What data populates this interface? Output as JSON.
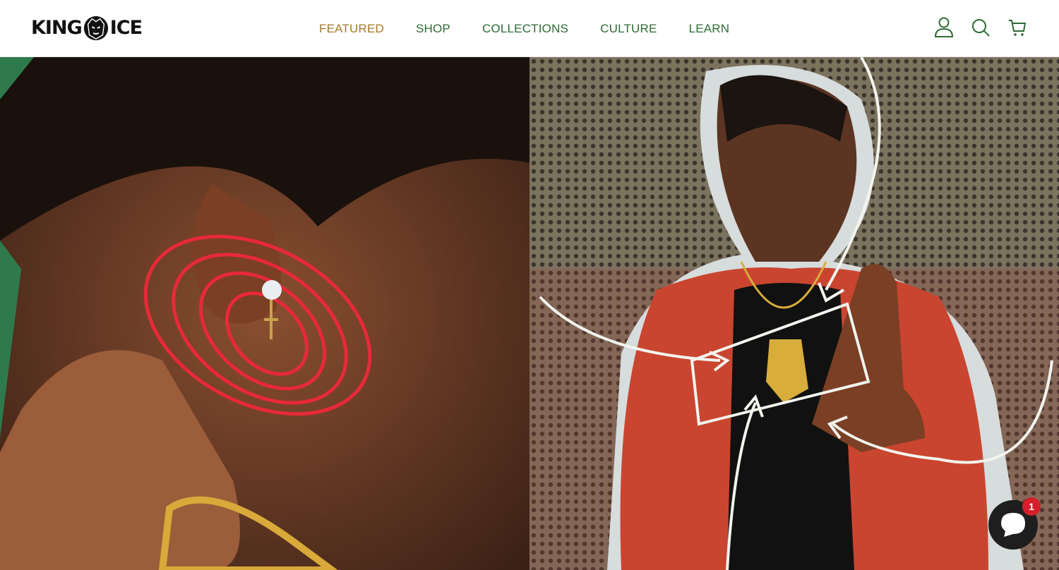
{
  "brand": {
    "logo_left": "KING",
    "logo_right": "ICE"
  },
  "nav": [
    {
      "label": "FEATURED",
      "active": true
    },
    {
      "label": "SHOP"
    },
    {
      "label": "COLLECTIONS"
    },
    {
      "label": "CULTURE"
    },
    {
      "label": "LEARN"
    }
  ],
  "header_icons": [
    "account-icon",
    "search-icon",
    "cart-icon"
  ],
  "chat": {
    "badge_count": "1"
  },
  "colors": {
    "nav_text": "#2e6b34",
    "nav_active": "#a47a2a",
    "badge": "#d61f2a",
    "scribble": "#e8293a"
  }
}
